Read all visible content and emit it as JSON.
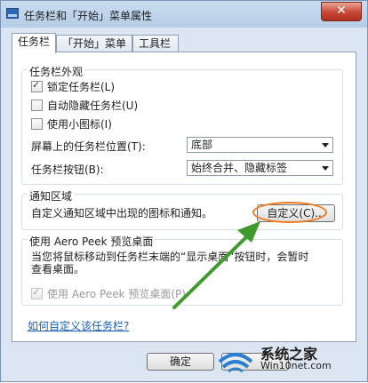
{
  "window": {
    "title": "任务栏和「开始」菜单属性",
    "close_label": "✕"
  },
  "tabs": [
    {
      "label": "任务栏"
    },
    {
      "label": "「开始」菜单"
    },
    {
      "label": "工具栏"
    }
  ],
  "appearance": {
    "title": "任务栏外观",
    "lock": {
      "label": "锁定任务栏(L)",
      "checked": true
    },
    "autohide": {
      "label": "自动隐藏任务栏(U)",
      "checked": false
    },
    "small_icons": {
      "label": "使用小图标(I)",
      "checked": false
    },
    "position": {
      "label": "屏幕上的任务栏位置(T):",
      "value": "底部"
    },
    "buttons": {
      "label": "任务栏按钮(B):",
      "value": "始终合并、隐藏标签"
    }
  },
  "notification": {
    "title": "通知区域",
    "description": "自定义通知区域中出现的图标和通知。",
    "customize_label": "自定义(C)..."
  },
  "aero_peek": {
    "title": "使用 Aero Peek 预览桌面",
    "description_line1": "当您将鼠标移动到任务栏末端的“显示桌面”按钮时，会暂时",
    "description_line2": "查看桌面。",
    "checkbox": {
      "label": "使用 Aero Peek 预览桌面(P)",
      "checked": true
    }
  },
  "help_link": "如何自定义该任务栏?",
  "footer": {
    "ok_label": "确定"
  },
  "watermark": {
    "line1": "系统之家",
    "line2": "Win10net.com"
  },
  "colors": {
    "accent_orange": "#f07a1c",
    "arrow_green": "#3f9a2e",
    "link_blue": "#1a5fb4"
  }
}
